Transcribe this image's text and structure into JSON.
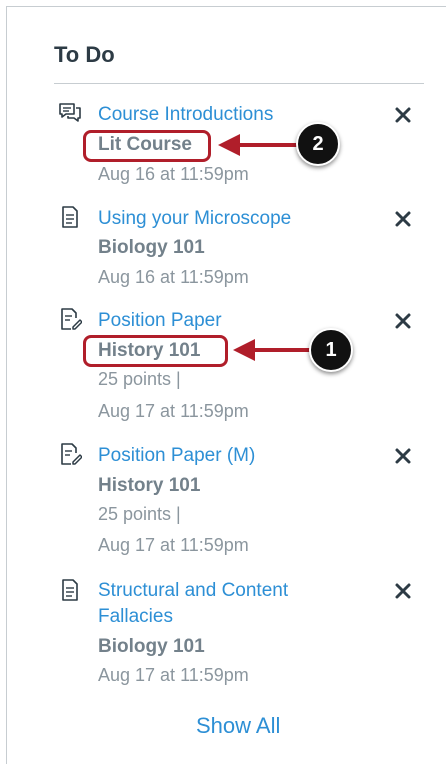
{
  "todo": {
    "title": "To Do",
    "items": [
      {
        "icon": "discussion-icon",
        "title": "Course Introductions",
        "course": "Lit Course",
        "points": "",
        "due": "Aug 16 at 11:59pm"
      },
      {
        "icon": "assignment-icon",
        "title": "Using your Microscope",
        "course": "Biology 101",
        "points": "",
        "due": "Aug 16 at 11:59pm"
      },
      {
        "icon": "assignment-edit-icon",
        "title": "Position Paper",
        "course": "History 101",
        "points": "25 points  |",
        "due": "Aug 17 at 11:59pm"
      },
      {
        "icon": "assignment-edit-icon",
        "title": "Position Paper (M)",
        "course": "History 101",
        "points": "25 points  |",
        "due": "Aug 17 at 11:59pm"
      },
      {
        "icon": "assignment-icon",
        "title": "Structural and Content Fallacies",
        "course": "Biology 101",
        "points": "",
        "due": "Aug 17 at 11:59pm"
      }
    ],
    "show_all_label": "Show All"
  },
  "callouts": {
    "first": "1",
    "second": "2"
  },
  "colors": {
    "link": "#2d8fd5",
    "annotation": "#b01e2a",
    "heading": "#2d3b45"
  }
}
